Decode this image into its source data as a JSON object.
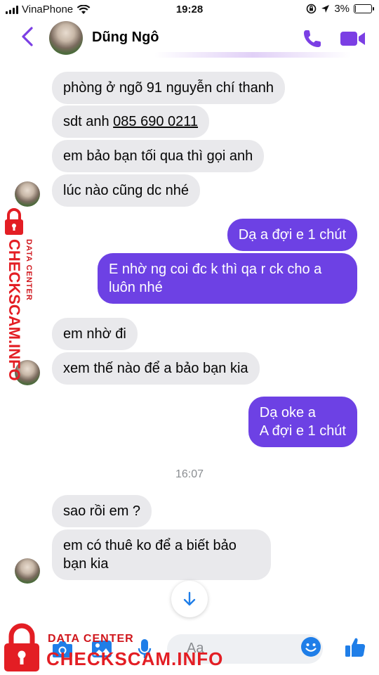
{
  "status_bar": {
    "carrier": "VinaPhone",
    "time": "19:28",
    "battery": "3%",
    "battery_level": 0.03
  },
  "header": {
    "contact_name": "Dũng Ngô",
    "icons": [
      "back-chevron-icon",
      "phone-icon",
      "video-camera-icon"
    ]
  },
  "messages": [
    {
      "dir": "in",
      "text": "phòng ở ngõ 91 nguyễn chí thanh"
    },
    {
      "dir": "in",
      "prefix": "sdt anh ",
      "link": "085 690 0211"
    },
    {
      "dir": "in",
      "text": "em bảo bạn tối qua thì gọi anh"
    },
    {
      "dir": "in",
      "text": "lúc nào cũng dc nhé"
    },
    {
      "dir": "out",
      "text": "Dạ a đợi e 1 chút"
    },
    {
      "dir": "out",
      "text": "E nhờ ng coi đc k thì qa r ck cho a luôn nhé"
    },
    {
      "dir": "in",
      "text": "em nhờ đi"
    },
    {
      "dir": "in",
      "text": "xem thế nào để a bảo bạn kia"
    },
    {
      "dir": "out",
      "lines": [
        "Dạ oke a",
        "A đợi e 1 chút"
      ]
    },
    {
      "dir": "in",
      "text": "sao rồi em ?"
    },
    {
      "dir": "in",
      "text": "em có thuê ko để a biết bảo bạn kia"
    }
  ],
  "timestamp": "16:07",
  "composer": {
    "placeholder": "Aa",
    "icons": [
      "camera-icon",
      "gallery-icon",
      "microphone-icon",
      "emoji-icon",
      "thumbs-up-icon"
    ]
  },
  "watermark": {
    "line1": "DATA CENTER",
    "line2": "CHECKSCAM.INFO"
  },
  "colors": {
    "accent": "#6d41e4",
    "incoming_bubble": "#e9e9ec",
    "watermark_red": "#e31e24"
  }
}
